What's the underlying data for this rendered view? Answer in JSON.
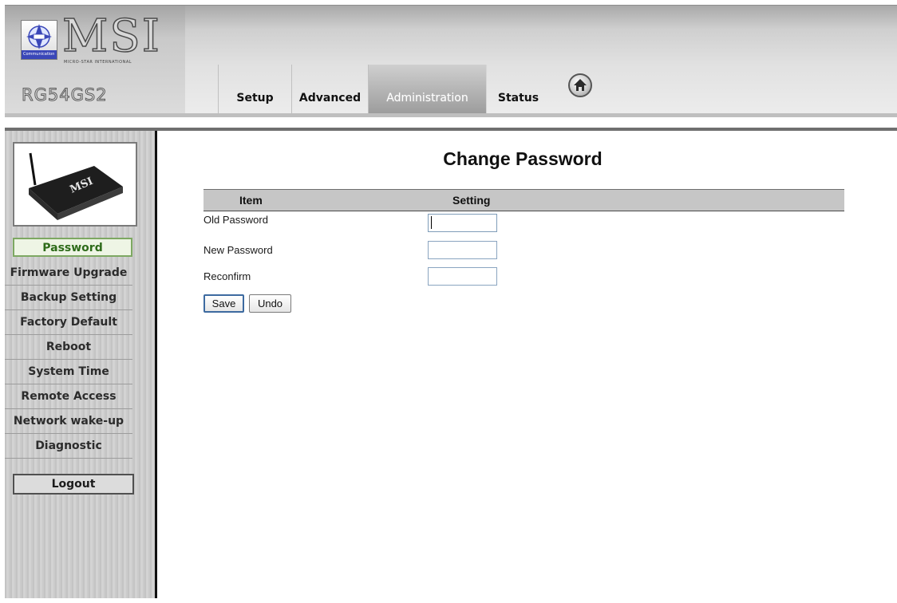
{
  "brand": {
    "wordmark": "MSI",
    "tagline": "MICRO-STAR INTERNATIONAL",
    "emblem_text": "Communication",
    "model": "RG54GS2"
  },
  "nav": {
    "tabs": [
      {
        "label": "Setup",
        "active": false
      },
      {
        "label": "Advanced",
        "active": false
      },
      {
        "label": "Administration",
        "active": true
      },
      {
        "label": "Status",
        "active": false
      }
    ],
    "home_icon": "home-icon"
  },
  "sidebar": {
    "device_image_label": "MSI",
    "items": [
      {
        "label": "Password",
        "active": true
      },
      {
        "label": "Firmware Upgrade",
        "active": false
      },
      {
        "label": "Backup Setting",
        "active": false
      },
      {
        "label": "Factory Default",
        "active": false
      },
      {
        "label": "Reboot",
        "active": false
      },
      {
        "label": "System Time",
        "active": false
      },
      {
        "label": "Remote Access",
        "active": false
      },
      {
        "label": "Network wake-up",
        "active": false
      },
      {
        "label": "Diagnostic",
        "active": false
      }
    ],
    "logout_label": "Logout"
  },
  "main": {
    "title": "Change Password",
    "table_header": {
      "item": "Item",
      "setting": "Setting"
    },
    "fields": [
      {
        "label": "Old Password",
        "value": ""
      },
      {
        "label": "New Password",
        "value": ""
      },
      {
        "label": "Reconfirm",
        "value": ""
      }
    ],
    "buttons": {
      "save": "Save",
      "undo": "Undo"
    }
  },
  "colors": {
    "active_menu_border": "#7da862",
    "active_menu_text": "#2e6b1a",
    "active_tab_text": "#ffffff"
  }
}
